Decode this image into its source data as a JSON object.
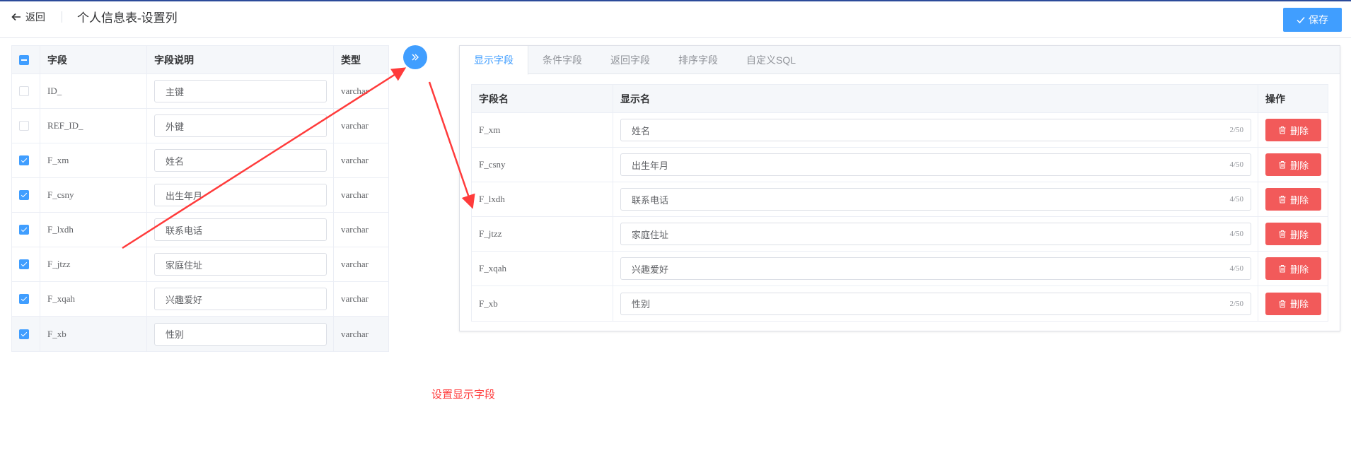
{
  "header": {
    "back_label": "返回",
    "title": "个人信息表-设置列",
    "save_label": "保存"
  },
  "left_table": {
    "columns": [
      "字段",
      "字段说明",
      "类型"
    ],
    "rows": [
      {
        "field": "ID_",
        "desc": "主键",
        "type": "varchar",
        "checked": false
      },
      {
        "field": "REF_ID_",
        "desc": "外键",
        "type": "varchar",
        "checked": false
      },
      {
        "field": "F_xm",
        "desc": "姓名",
        "type": "varchar",
        "checked": true
      },
      {
        "field": "F_csny",
        "desc": "出生年月",
        "type": "varchar",
        "checked": true
      },
      {
        "field": "F_lxdh",
        "desc": "联系电话",
        "type": "varchar",
        "checked": true
      },
      {
        "field": "F_jtzz",
        "desc": "家庭住址",
        "type": "varchar",
        "checked": true
      },
      {
        "field": "F_xqah",
        "desc": "兴趣爱好",
        "type": "varchar",
        "checked": true
      },
      {
        "field": "F_xb",
        "desc": "性别",
        "type": "varchar",
        "checked": true
      }
    ]
  },
  "tabs": [
    "显示字段",
    "条件字段",
    "返回字段",
    "排序字段",
    "自定义SQL"
  ],
  "right_table": {
    "columns": [
      "字段名",
      "显示名",
      "操作"
    ],
    "delete_label": "删除",
    "rows": [
      {
        "field": "F_xm",
        "display": "姓名",
        "count": "2/50"
      },
      {
        "field": "F_csny",
        "display": "出生年月",
        "count": "4/50"
      },
      {
        "field": "F_lxdh",
        "display": "联系电话",
        "count": "4/50"
      },
      {
        "field": "F_jtzz",
        "display": "家庭住址",
        "count": "4/50"
      },
      {
        "field": "F_xqah",
        "display": "兴趣爱好",
        "count": "4/50"
      },
      {
        "field": "F_xb",
        "display": "性别",
        "count": "2/50"
      }
    ]
  },
  "annotation": "设置显示字段",
  "colors": {
    "primary": "#409eff",
    "danger": "#f25a5a",
    "annotation": "#ff3b3b"
  }
}
